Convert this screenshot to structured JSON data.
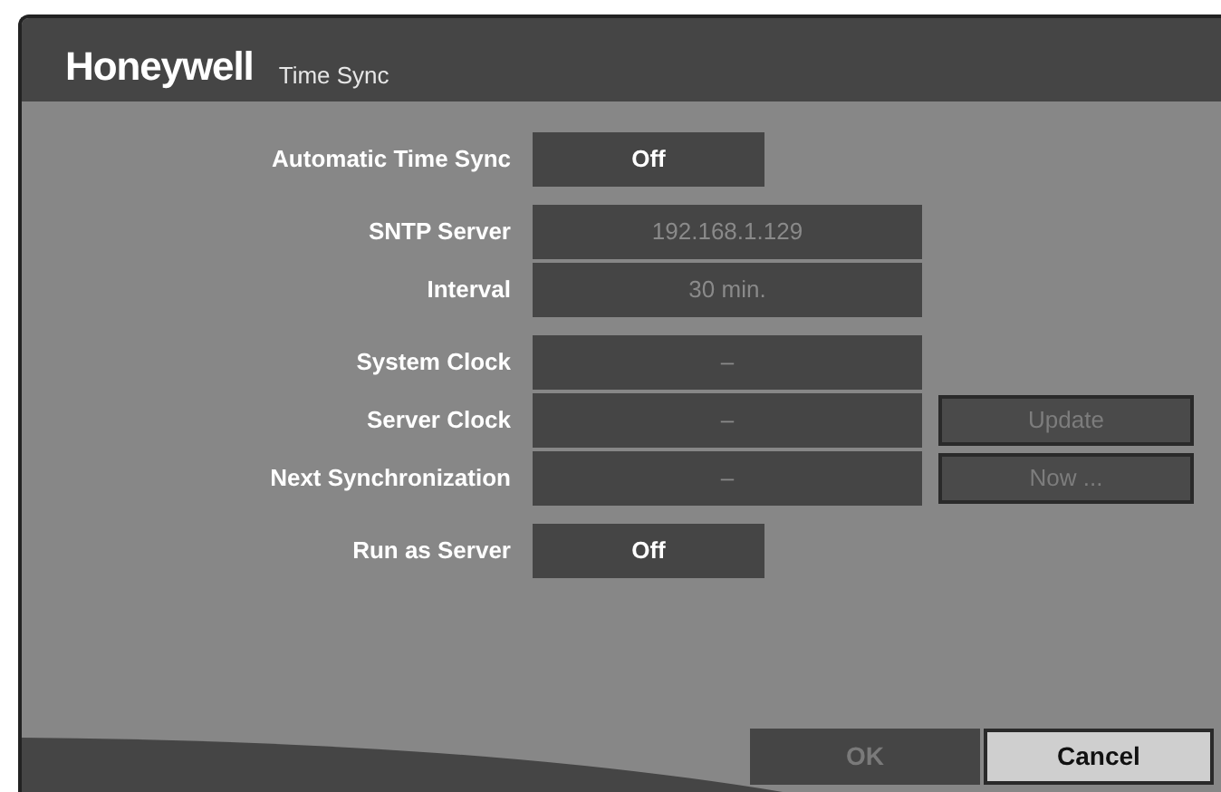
{
  "header": {
    "brand": "Honeywell",
    "title": "Time Sync"
  },
  "groups": [
    [
      {
        "label": "Automatic Time Sync",
        "kind": "toggle",
        "value": "Off",
        "disabled": false
      }
    ],
    [
      {
        "label": "SNTP Server",
        "kind": "field",
        "value": "192.168.1.129",
        "disabled": true
      },
      {
        "label": "Interval",
        "kind": "field",
        "value": "30 min.",
        "disabled": true
      }
    ],
    [
      {
        "label": "System Clock",
        "kind": "field",
        "value": "–",
        "disabled": true
      },
      {
        "label": "Server Clock",
        "kind": "field",
        "value": "–",
        "disabled": true,
        "button": {
          "label": "Update",
          "disabled": true
        }
      },
      {
        "label": "Next Synchronization",
        "kind": "field",
        "value": "–",
        "disabled": true,
        "button": {
          "label": "Now ...",
          "disabled": true
        }
      }
    ],
    [
      {
        "label": "Run as Server",
        "kind": "toggle",
        "value": "Off",
        "disabled": false
      }
    ]
  ],
  "footer_buttons": [
    {
      "label": "OK",
      "disabled": true,
      "selected": false
    },
    {
      "label": "Cancel",
      "disabled": false,
      "selected": true
    }
  ]
}
